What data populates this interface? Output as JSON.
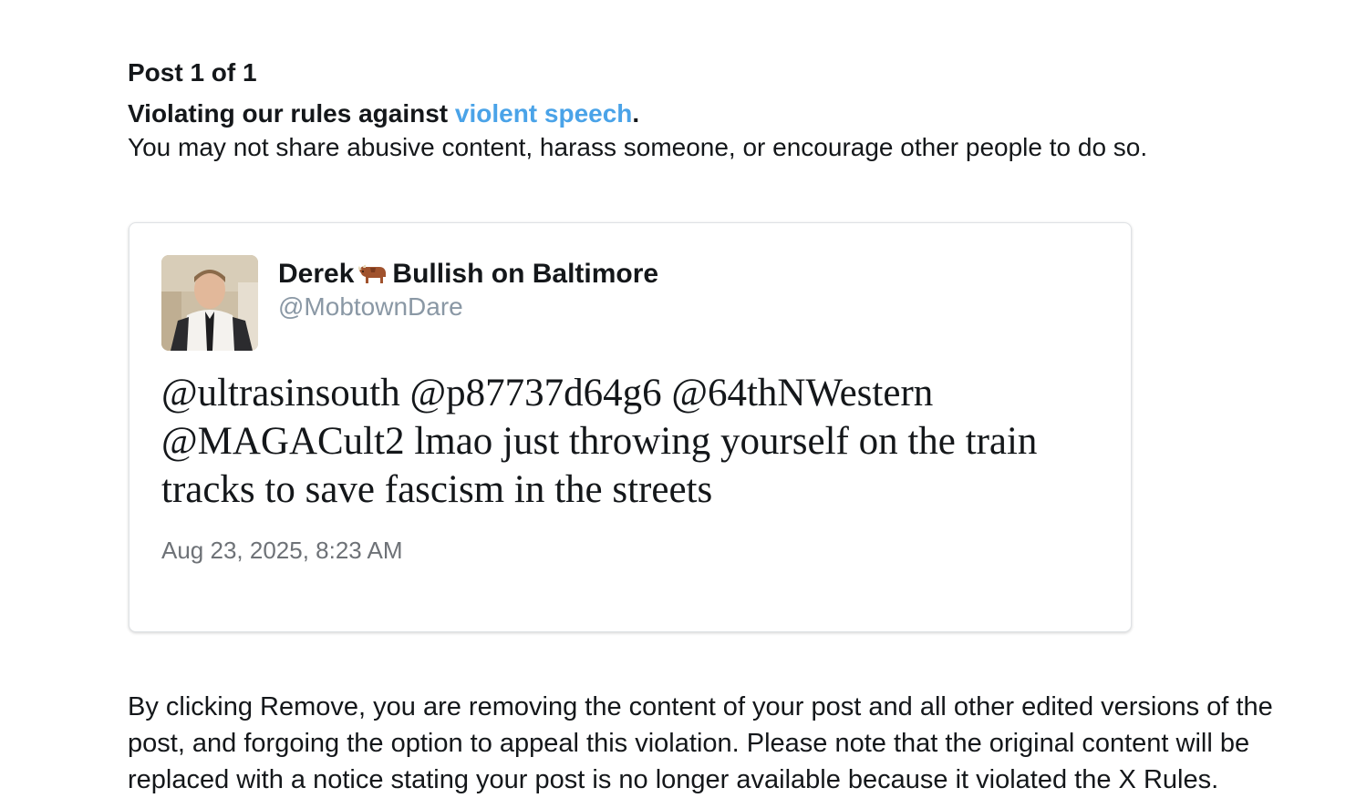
{
  "header": {
    "post_count": "Post 1 of 1",
    "violation_prefix": "Violating our rules against ",
    "violation_link": "violent speech",
    "violation_suffix": ".",
    "violation_description": "You may not share abusive content, harass someone, or encourage other people to do so."
  },
  "tweet": {
    "author_name_part1": "Derek",
    "author_emoji_icon": "ox-icon",
    "author_name_part2": "Bullish on Baltimore",
    "author_handle": "@MobtownDare",
    "text": "@ultrasinsouth @p87737d64g6 @64thNWestern @MAGACult2 lmao just throwing yourself on the train tracks to save fascism in the streets",
    "timestamp": "Aug 23, 2025, 8:23 AM"
  },
  "notice": {
    "text": "By clicking Remove, you are removing the content of your post and all other edited versions of the post, and forgoing the option to appeal this violation. Please note that the original content will be replaced with a notice stating your post is no longer available because it violated the X Rules."
  },
  "colors": {
    "link": "#4aa3e8",
    "handle": "#8a98a5",
    "timestamp": "#6e7277",
    "text": "#14171a"
  }
}
